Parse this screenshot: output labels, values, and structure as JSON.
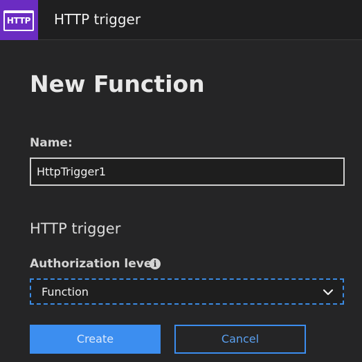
{
  "header": {
    "logo_text": "HTTP",
    "title": "HTTP trigger",
    "logo_color": "#6b2cc2"
  },
  "form": {
    "heading": "New Function",
    "name_label": "Name:",
    "name_value": "HttpTrigger1",
    "section_title": "HTTP trigger",
    "auth_label": "Authorization level",
    "auth_info_icon": "info-icon",
    "auth_value": "Function"
  },
  "buttons": {
    "create_label": "Create",
    "cancel_label": "Cancel",
    "accent_color": "#3c8ef0"
  }
}
